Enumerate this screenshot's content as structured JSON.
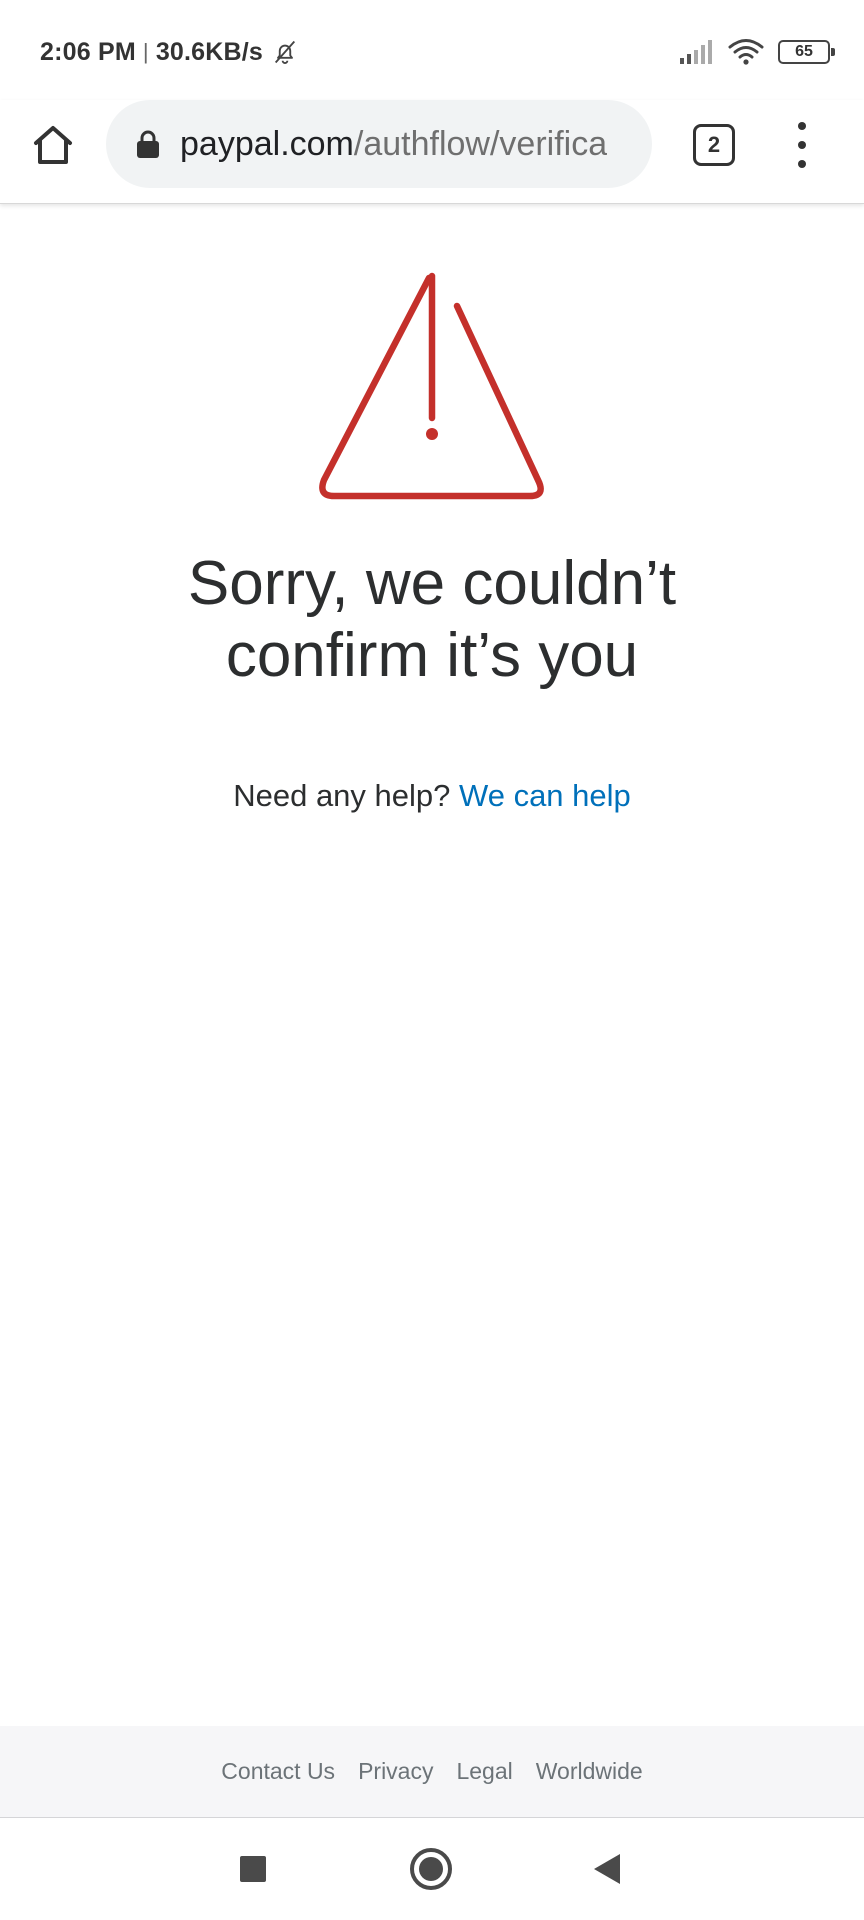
{
  "status_bar": {
    "time": "2:06 PM",
    "separator": "|",
    "network_speed": "30.6KB/s",
    "battery": "65",
    "icons": [
      "bell-off-icon",
      "signal-icon",
      "wifi-icon",
      "battery-icon"
    ]
  },
  "browser": {
    "url_domain": "paypal.com",
    "url_path": "/authflow/verifica",
    "tab_count": "2",
    "icons": [
      "home-icon",
      "lock-icon",
      "tabs-icon",
      "more-vert-icon"
    ]
  },
  "main": {
    "icon": "warning-triangle-icon",
    "heading_line1": "Sorry, we couldn’t",
    "heading_line2": "confirm it’s you",
    "help_prompt": "Need any help?",
    "help_link": "We can help"
  },
  "footer": {
    "links": [
      "Contact Us",
      "Privacy",
      "Legal",
      "Worldwide"
    ]
  },
  "colors": {
    "warning_red": "#c4302b",
    "link_blue": "#0070ba",
    "text_dark": "#2c2e2f",
    "footer_text": "#6c7378"
  }
}
